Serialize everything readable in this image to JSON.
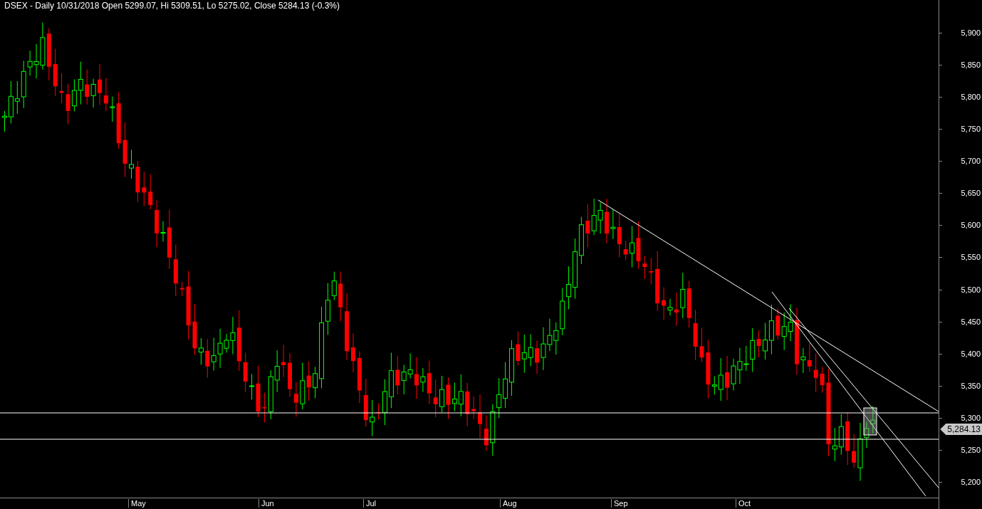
{
  "chart_title": "DSEX - Daily 10/31/2018 Open 5299.07, Hi 5309.51, Lo 5275.02, Close 5284.13 (-0.3%)",
  "y_axis_labels": [
    "5,900",
    "5,850",
    "5,800",
    "5,750",
    "5,700",
    "5,650",
    "5,600",
    "5,550",
    "5,500",
    "5,450",
    "5,400",
    "5,350",
    "5,300",
    "5,250",
    "5,200"
  ],
  "x_axis_labels": [
    "May",
    "Jun",
    "Jul",
    "Aug",
    "Sep",
    "Oct"
  ],
  "last_price_label": "5,284.13"
}
